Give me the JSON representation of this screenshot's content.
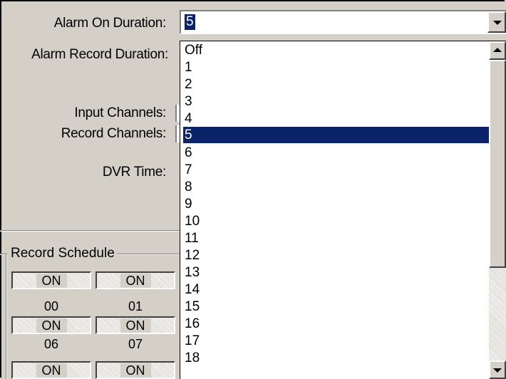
{
  "labels": {
    "alarm_on_duration": "Alarm On Duration:",
    "alarm_record_duration": "Alarm Record Duration:",
    "input_channels": "Input Channels:",
    "record_channels": "Record Channels:",
    "dvr_time": "DVR Time:"
  },
  "combo": {
    "selected": "5",
    "options": [
      "Off",
      "1",
      "2",
      "3",
      "4",
      "5",
      "6",
      "7",
      "8",
      "9",
      "10",
      "11",
      "12",
      "13",
      "14",
      "15",
      "16",
      "17",
      "18"
    ]
  },
  "schedule": {
    "title": "Record Schedule",
    "row1": {
      "btn0": "ON",
      "btn1": "ON"
    },
    "hours1": {
      "h0": "00",
      "h1": "01"
    },
    "row2": {
      "btn0": "ON",
      "btn1": "ON"
    },
    "hours2": {
      "h0": "06",
      "h1": "07"
    },
    "row3": {
      "btn0": "ON",
      "btn1": "ON"
    }
  },
  "colors": {
    "selection": "#0a246a",
    "face": "#d4d0c8"
  }
}
